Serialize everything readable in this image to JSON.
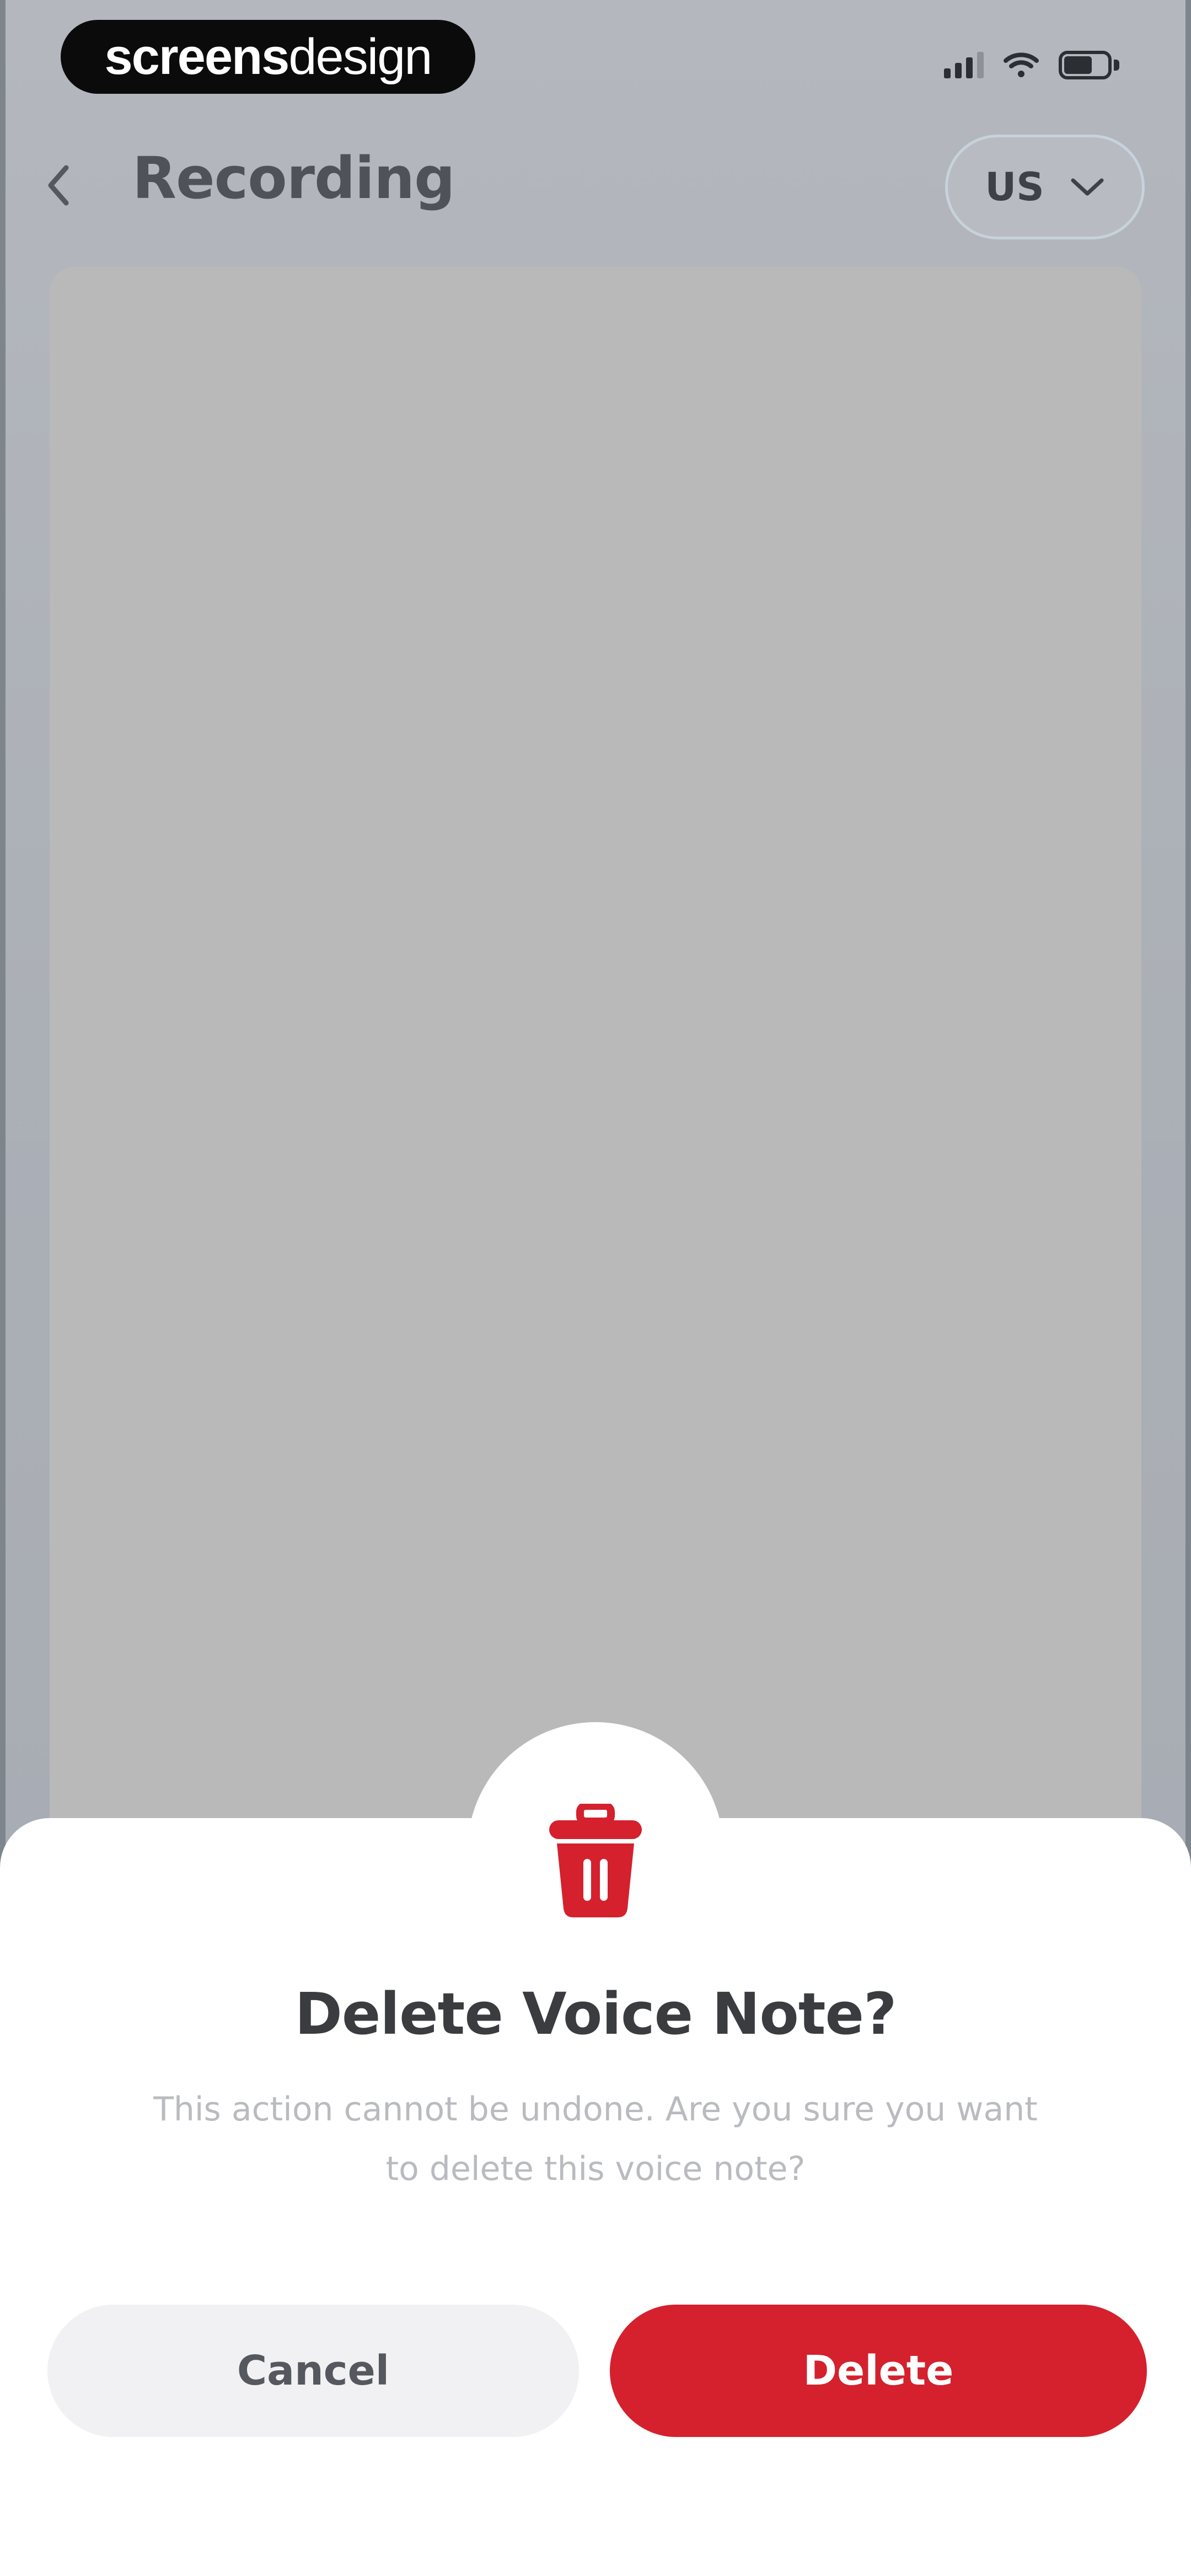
{
  "status_bar": {
    "brand_bold": "screens",
    "brand_light": "design"
  },
  "header": {
    "title": "Recording",
    "language": "US"
  },
  "content": {
    "transcript_placeholder": " "
  },
  "dialog": {
    "title": "Delete Voice Note?",
    "message_line1": "This action cannot be undone. Are you sure you want",
    "message_line2": "to delete this voice note?",
    "cancel_label": "Cancel",
    "delete_label": "Delete"
  },
  "colors": {
    "accent": "#d4212d",
    "title": "#3a3c40",
    "cancel_bg": "#f1f1f3"
  },
  "icons": [
    "back-chevron-icon",
    "chevron-down-icon",
    "trash-icon",
    "signal-icon",
    "wifi-icon",
    "battery-icon"
  ]
}
